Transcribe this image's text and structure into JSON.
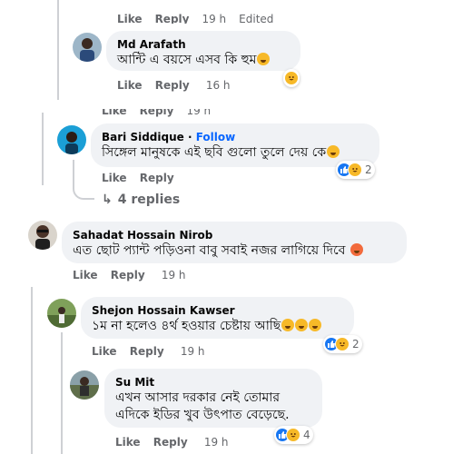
{
  "partial_top": {
    "like": "Like",
    "reply": "Reply",
    "time": "19 h",
    "edited": "Edited"
  },
  "partial_mid": {
    "like": "Like",
    "reply": "Reply",
    "time": "19 h"
  },
  "comments": [
    {
      "author": "Md Arafath",
      "text": "আন্টি এ বয়সে এসব কি হুম",
      "like": "Like",
      "reply": "Reply",
      "time": "16 h"
    },
    {
      "author": "Bari Siddique",
      "follow": "Follow",
      "separator": "·",
      "text": "সিঙ্গেল মানুষকে এই ছবি গুলো তুলে দেয় কে",
      "like": "Like",
      "reply": "Reply",
      "time": "",
      "reactions": {
        "icons": [
          "like-icon",
          "haha-icon"
        ],
        "count": "2"
      },
      "replies_label": "4 replies"
    },
    {
      "author": "Sahadat Hossain Nirob",
      "text": "এত ছোট প্যান্ট পড়িওনা বাবু সবাই নজর লাগিয়ে দিবে",
      "like": "Like",
      "reply": "Reply",
      "time": "19 h"
    },
    {
      "author": "Shejon Hossain Kawser",
      "text": "১ম না হলেও ৪র্থ হওয়ার চেষ্টায় আছি",
      "like": "Like",
      "reply": "Reply",
      "time": "19 h",
      "reactions": {
        "icons": [
          "like-icon",
          "haha-icon"
        ],
        "count": "2"
      }
    },
    {
      "author": "Su Mit",
      "text_line1": "এখন আসার দরকার নেই তোমার",
      "text_line2": "এদিকে ইডির খুব উৎপাত বেড়েছে.",
      "like": "Like",
      "reply": "Reply",
      "time": "19 h",
      "reactions": {
        "icons": [
          "like-icon",
          "haha-icon"
        ],
        "count": "4"
      }
    }
  ],
  "colors": {
    "bubble": "#f0f2f5",
    "muted": "#65676b",
    "follow": "#0866ff",
    "like": "#1877f2",
    "haha": "#f7b928"
  }
}
